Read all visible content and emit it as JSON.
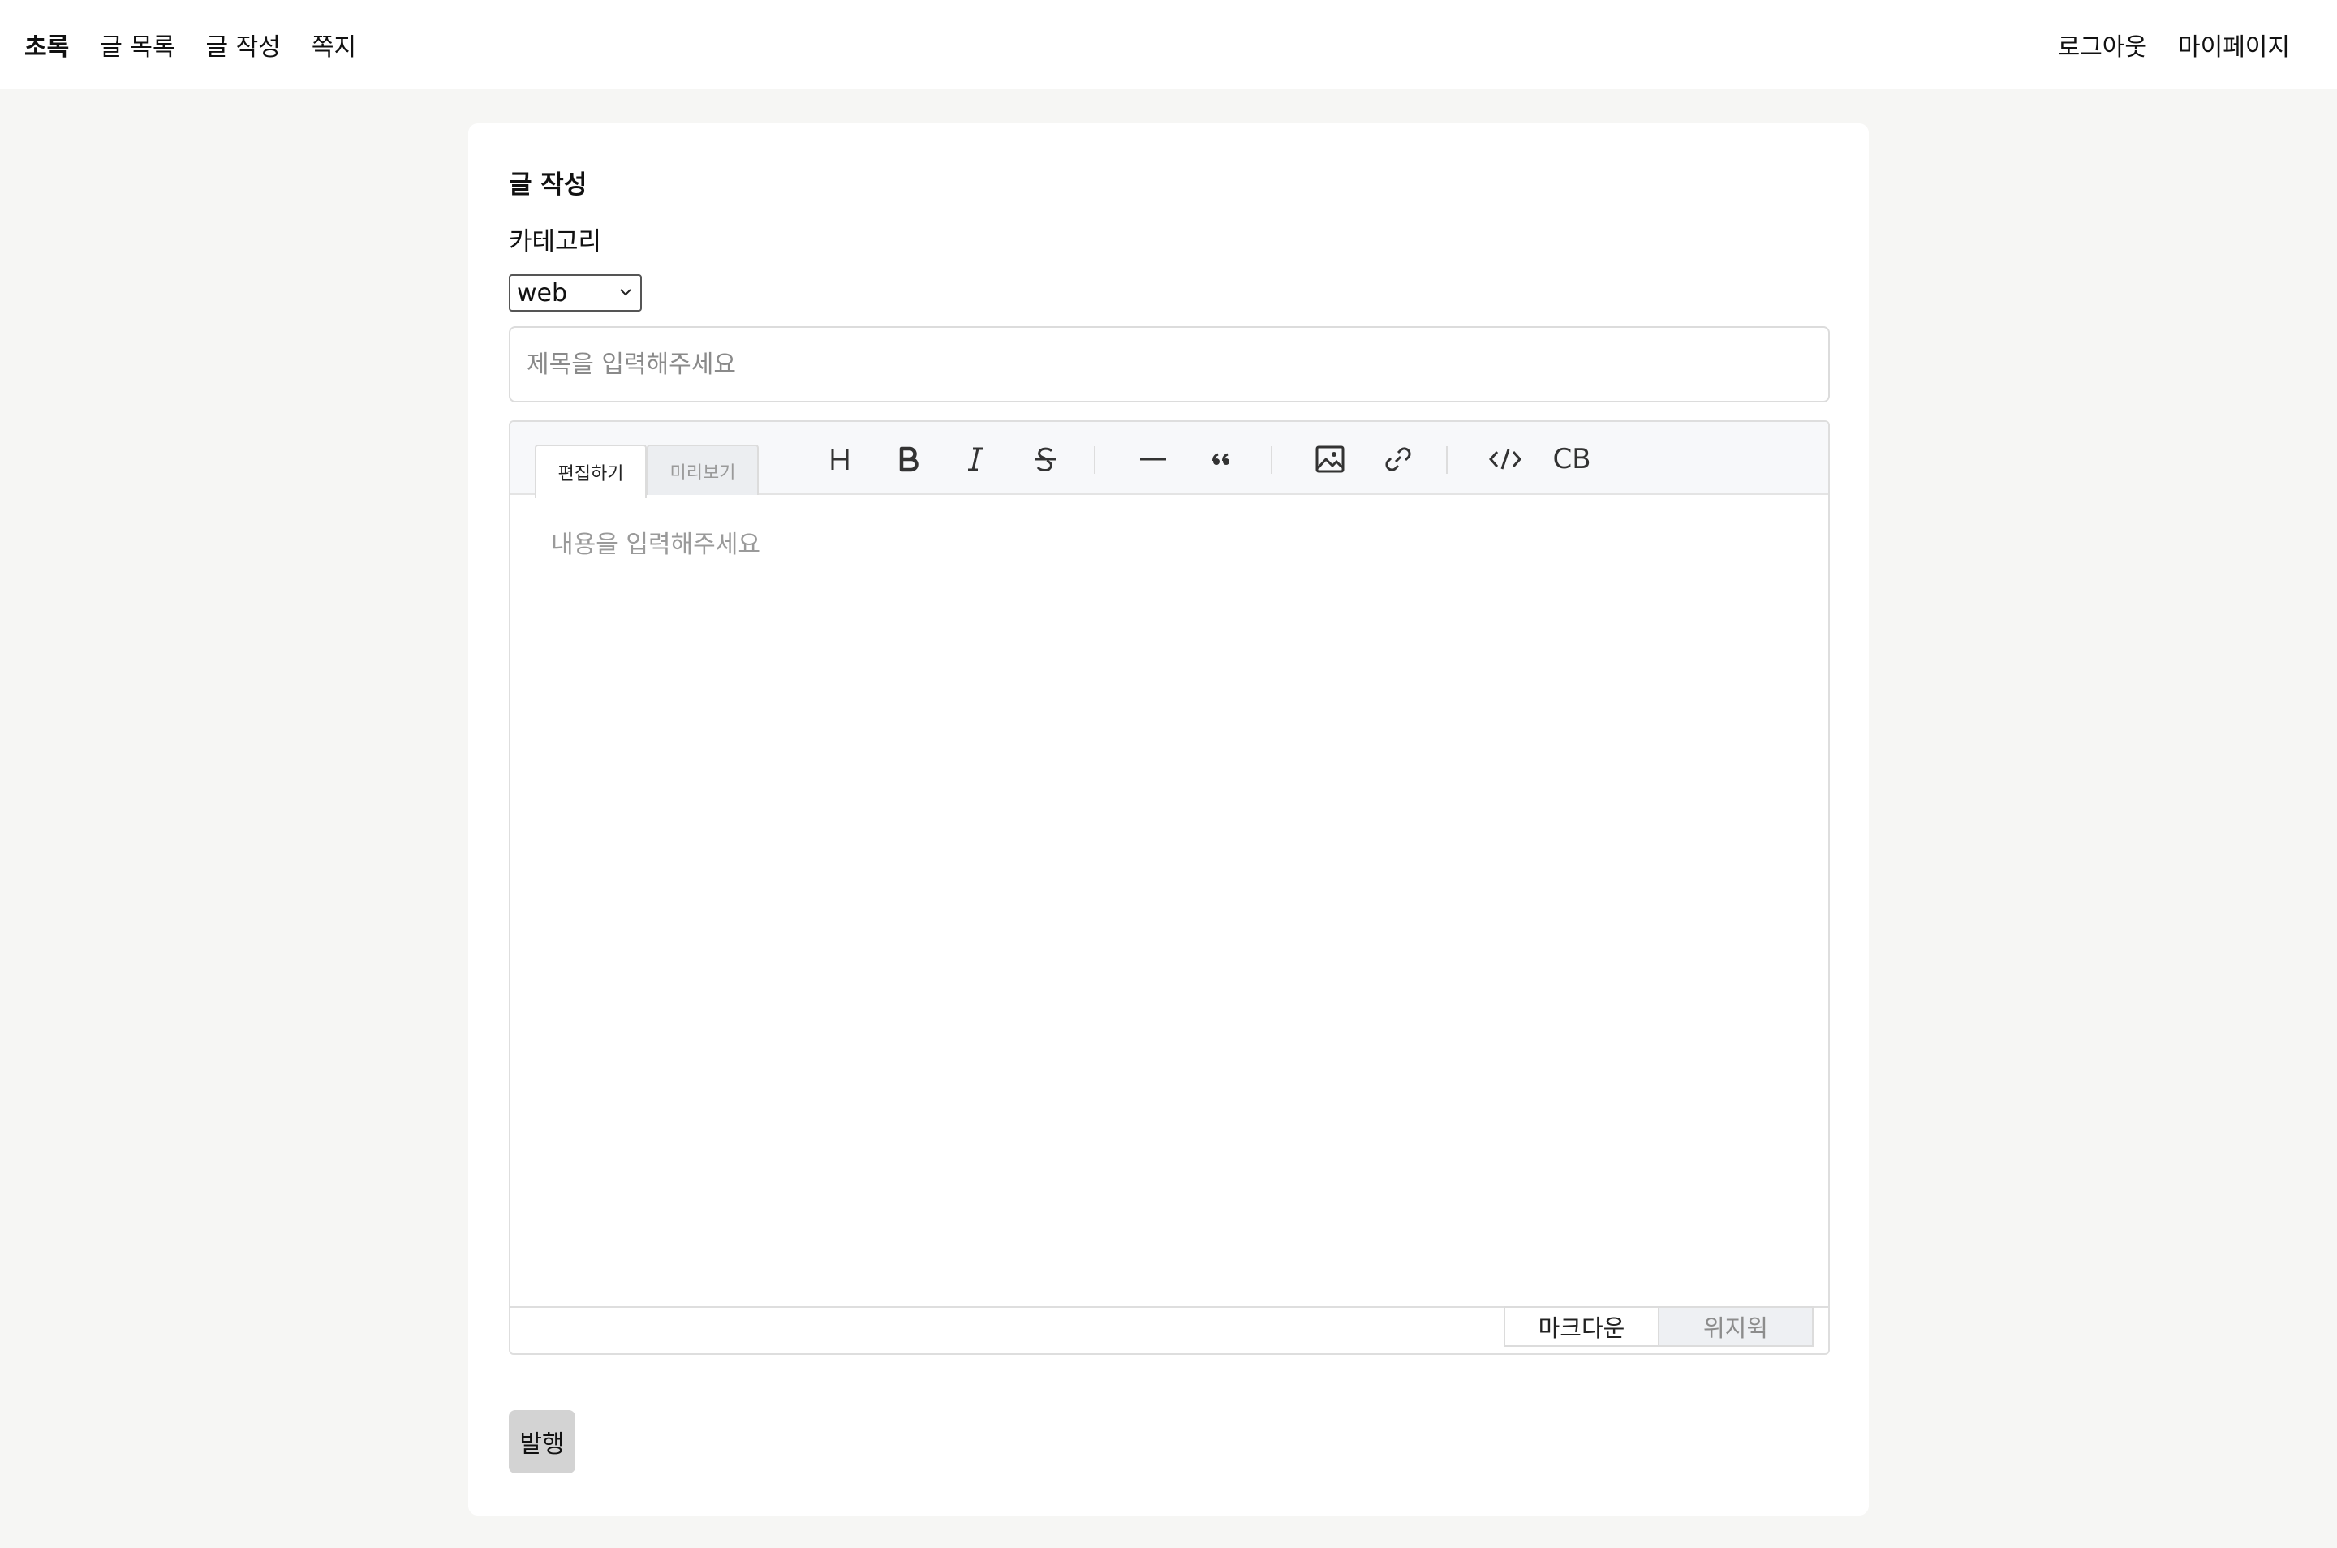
{
  "nav": {
    "brand": "초록",
    "post_list": "글 목록",
    "write_post": "글 작성",
    "messages": "쪽지",
    "logout": "로그아웃",
    "mypage": "마이페이지"
  },
  "form": {
    "title": "글 작성",
    "category_label": "카테고리",
    "category_selected": "web",
    "title_placeholder": "제목을 입력해주세요",
    "content_placeholder": "내용을 입력해주세요",
    "publish_label": "발행"
  },
  "editor": {
    "tabs": {
      "edit": "편집하기",
      "preview": "미리보기"
    },
    "toolbar_icons": [
      "heading-icon",
      "bold-icon",
      "italic-icon",
      "strike-icon",
      "hr-icon",
      "quote-icon",
      "image-icon",
      "link-icon",
      "code-icon",
      "codeblock-icon"
    ],
    "codeblock_label": "CB",
    "modes": {
      "markdown": "마크다운",
      "wysiwyg": "위지윅"
    }
  },
  "colors": {
    "page_bg": "#f6f6f4",
    "card_bg": "#ffffff",
    "publish_bg": "#d3d3d3",
    "toolbar_bg": "#f7f8fa"
  }
}
